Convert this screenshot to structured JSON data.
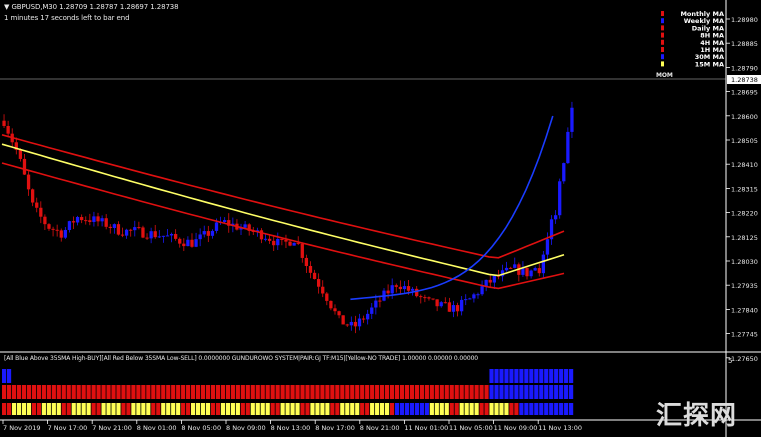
{
  "window": {
    "symbol_line": "GBPUSD,M30  1.28709 1.28787 1.28697 1.28738",
    "bar_timer": "1 minutes 17 seconds left to bar end"
  },
  "price_axis": {
    "ticks": [
      "1.28980",
      "1.28885",
      "1.28790",
      "1.28695",
      "1.28600",
      "1.28505",
      "1.28410",
      "1.28315",
      "1.28220",
      "1.28125",
      "1.28030",
      "1.27935",
      "1.27840",
      "1.27745",
      "1.27650"
    ],
    "current_price": "1.28738"
  },
  "time_axis": {
    "ticks": [
      "7 Nov 2019",
      "7 Nov 17:00",
      "7 Nov 21:00",
      "8 Nov 01:00",
      "8 Nov 05:00",
      "8 Nov 09:00",
      "8 Nov 13:00",
      "8 Nov 17:00",
      "8 Nov 21:00",
      "11 Nov 01:00",
      "11 Nov 05:00",
      "11 Nov 09:00",
      "11 Nov 13:00"
    ]
  },
  "ma_legend": {
    "items": [
      {
        "label": "Monthly MA",
        "marker": "red"
      },
      {
        "label": "Weekly MA",
        "marker": "blue"
      },
      {
        "label": "Daily MA",
        "marker": "red"
      },
      {
        "label": "8H MA",
        "marker": "red"
      },
      {
        "label": "4H MA",
        "marker": "red"
      },
      {
        "label": "1H MA",
        "marker": "red"
      },
      {
        "label": "30M MA",
        "marker": "blue"
      },
      {
        "label": "15M MA",
        "marker": "yellow"
      }
    ],
    "mom_label": "MOM"
  },
  "indicator": {
    "title": "[All Blue Above 35SMA High-BUY][All Red Below 35SMA Low-SELL] 0.0000000  GUNDUROWO SYSTEM|PAIR:GJ TF:M15|[Yellow-NO TRADE] 1.00000 0.00000 0.00000",
    "right_label": "5"
  },
  "watermark": {
    "text": "汇探网"
  },
  "colors": {
    "bull": "#1a1aff",
    "bear": "#e01010",
    "ma_yellow": "#ffff66",
    "ma_red": "#e01010",
    "ma_blue": "#1a3cff",
    "neutral": "#ffff55",
    "grid_text": "#e8e8e8"
  },
  "chart_data": {
    "type": "candlestick",
    "symbol": "GBPUSD",
    "timeframe": "M30",
    "ylim": [
      1.2765,
      1.2905
    ],
    "last": {
      "open": 1.28709,
      "high": 1.28787,
      "low": 1.28697,
      "close": 1.28738
    },
    "close_path": [
      1.2863,
      1.2848,
      1.2826,
      1.2818,
      1.2815,
      1.2822,
      1.2821,
      1.2819,
      1.2816,
      1.2816,
      1.2815,
      1.2814,
      1.2812,
      1.2811,
      1.2815,
      1.282,
      1.2818,
      1.2816,
      1.2814,
      1.281,
      1.2813,
      1.2799,
      1.279,
      1.2778,
      1.2775,
      1.2781,
      1.2788,
      1.2794,
      1.279,
      1.2786,
      1.2784,
      1.2783,
      1.2787,
      1.2793,
      1.2797,
      1.28,
      1.2798,
      1.2803,
      1.283,
      1.2873
    ],
    "bands": {
      "upper_red_start": 1.2857,
      "upper_red_end": 1.2798,
      "yellow_start": 1.2853,
      "yellow_end": 1.279,
      "lower_red_start": 1.2845,
      "lower_red_end": 1.2785
    },
    "indicator_rows": [
      {
        "row": 1,
        "colors": "mostly-neutral; blue at end"
      },
      {
        "row": 2,
        "colors": "red majority; blue at end"
      },
      {
        "row": 3,
        "colors": "mixed red/yellow; blue segments"
      }
    ]
  }
}
